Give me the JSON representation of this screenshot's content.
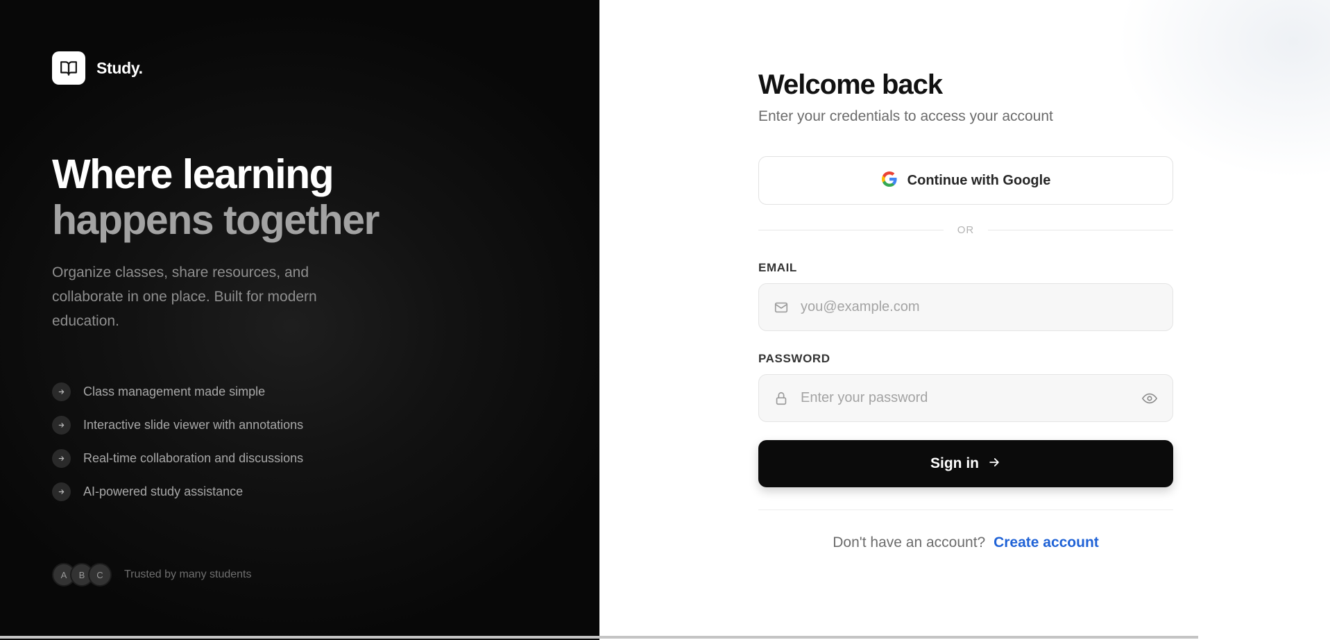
{
  "brand": {
    "name": "Study.",
    "logo_icon": "open-book-icon"
  },
  "hero": {
    "line1": "Where learning",
    "line2": "happens together",
    "tagline": "Organize classes, share resources, and collaborate in one place. Built for modern education."
  },
  "features": [
    {
      "label": "Class management made simple",
      "icon": "arrow-right-icon"
    },
    {
      "label": "Interactive slide viewer with annotations",
      "icon": "arrow-right-icon"
    },
    {
      "label": "Real-time collaboration and discussions",
      "icon": "arrow-right-icon"
    },
    {
      "label": "AI-powered study assistance",
      "icon": "arrow-right-icon"
    }
  ],
  "trust": {
    "avatars": [
      "A",
      "B",
      "C"
    ],
    "text": "Trusted by many students"
  },
  "login": {
    "title": "Welcome back",
    "subtitle": "Enter your credentials to access your account",
    "google_button": "Continue with Google",
    "divider": "OR",
    "email_label": "EMAIL",
    "email_placeholder": "you@example.com",
    "email_value": "",
    "password_label": "PASSWORD",
    "password_placeholder": "Enter your password",
    "password_value": "",
    "signin_button": "Sign in",
    "signup_prompt": "Don't have an account?",
    "signup_link": "Create account"
  },
  "colors": {
    "left_panel_bg": "#0a0a0a",
    "accent_link": "#1f62d6",
    "primary_button": "#0b0b0b"
  }
}
